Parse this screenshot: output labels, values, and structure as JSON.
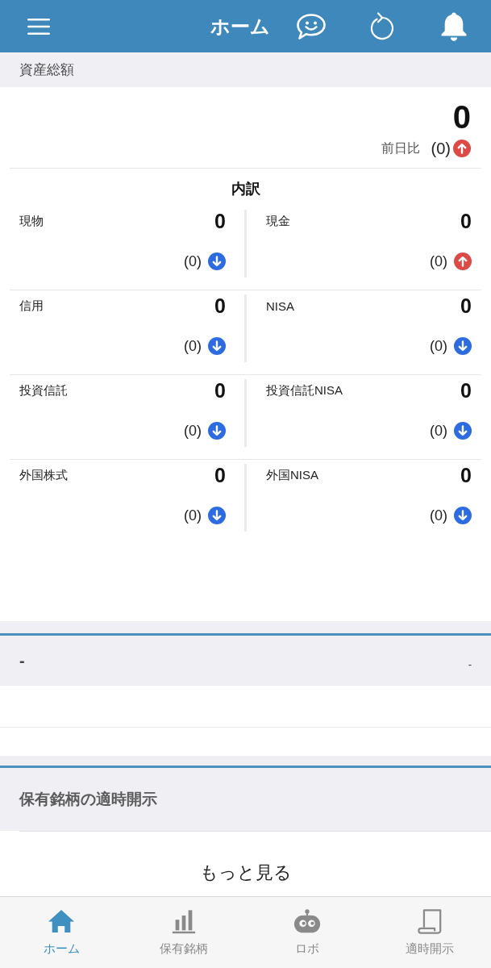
{
  "header": {
    "title": "ホーム"
  },
  "total_assets": {
    "section_title": "資産総額",
    "value": "0",
    "change_label": "前日比",
    "change": "(0)",
    "rising": true
  },
  "breakdown": {
    "title": "内訳",
    "items": [
      {
        "label": "現物",
        "value": "0",
        "change": "(0)",
        "rising": false
      },
      {
        "label": "現金",
        "value": "0",
        "change": "(0)",
        "rising": true
      },
      {
        "label": "信用",
        "value": "0",
        "change": "(0)",
        "rising": false
      },
      {
        "label": "NISA",
        "value": "0",
        "change": "(0)",
        "rising": false
      },
      {
        "label": "投資信託",
        "value": "0",
        "change": "(0)",
        "rising": false
      },
      {
        "label": "投資信託NISA",
        "value": "0",
        "change": "(0)",
        "rising": false
      },
      {
        "label": "外国株式",
        "value": "0",
        "change": "(0)",
        "rising": false
      },
      {
        "label": "外国NISA",
        "value": "0",
        "change": "(0)",
        "rising": false
      }
    ]
  },
  "summary": {
    "left": "-",
    "right": "-"
  },
  "disclosures": {
    "title": "保有銘柄の適時開示",
    "more_link": "もっと見る"
  },
  "tab_bar": [
    {
      "label": "ホーム",
      "selected": true
    },
    {
      "label": "保有銘柄",
      "selected": false
    },
    {
      "label": "ロボ",
      "selected": false
    },
    {
      "label": "適時開示",
      "selected": false
    }
  ]
}
